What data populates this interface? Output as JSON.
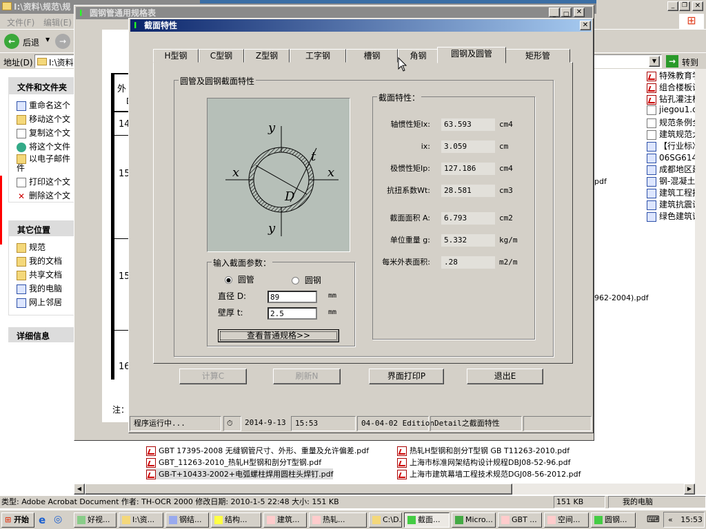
{
  "explorer": {
    "title": "I:\\资料\\规范\\规",
    "menu": [
      "文件(F)",
      "编辑(E)"
    ],
    "back_label": "后退",
    "address_label": "地址(D)",
    "address_value": "I:\\资料",
    "go_label": "转到",
    "tasks_header": "文件和文件夹",
    "tasks": [
      "重命名这个",
      "移动这个文",
      "复制这个文",
      "将这个文件",
      "以电子邮件\n件",
      "打印这个文",
      "删除这个文"
    ],
    "places_header": "其它位置",
    "places": [
      "规范",
      "我的文档",
      "共享文档",
      "我的电脑",
      "网上邻居"
    ],
    "details_header": "详细信息",
    "right_files": [
      {
        "name": "特殊教育学校",
        "type": "pdf"
      },
      {
        "name": "组合楼板设计",
        "type": "pdf"
      },
      {
        "name": "钻孔灌注桩施",
        "type": "pdf"
      },
      {
        "name": "jiegou1.chm",
        "type": "chm"
      },
      {
        "name": "规范条例全集",
        "type": "chm"
      },
      {
        "name": "建筑规范大全",
        "type": "chm"
      },
      {
        "name": "【行业标准】",
        "type": "doc"
      },
      {
        "name": "06SG614-1砌体",
        "type": "doc"
      },
      {
        "name": "成都地区建筑",
        "type": "doc"
      },
      {
        "name": "钢-混凝土组合",
        "type": "doc"
      },
      {
        "name": "建筑工程抗震",
        "type": "doc"
      },
      {
        "name": "建筑抗震设计",
        "type": "doc"
      },
      {
        "name": "绿色建筑评价",
        "type": "doc"
      }
    ],
    "partial_texts": [
      "pdf",
      "962-2004).pdf"
    ],
    "bottom_files_left": [
      "GBT 17395-2008 无缝钢管尺寸、外形、重量及允许偏差.pdf",
      "GBT_11263-2010_热轧H型钢和剖分T型钢.pdf",
      "GB-T+10433-2002+电弧螺柱焊用圆柱头焊钉.pdf"
    ],
    "bottom_files_right": [
      "热轧H型钢和剖分T型钢 GB T11263-2010.pdf",
      "上海市标准网架结构设计规程DBJ08-52-96.pdf",
      "上海市建筑幕墙工程技术规范DGJ08-56-2012.pdf"
    ],
    "status": "类型: Adobe Acrobat Document 作者: TH-OCR 2000 修改日期: 2010-1-5 22:48 大小: 151 KB",
    "status_size": "151 KB",
    "status_location": "我的电脑"
  },
  "spec_window": {
    "title": "圆钢管通用规格表",
    "table_cells": [
      "外",
      "D",
      "14",
      "15",
      "15",
      "16"
    ],
    "note": "注："
  },
  "dialog": {
    "title": "截面特性",
    "tabs": [
      "H型钢",
      "C型钢",
      "Z型钢",
      "工字钢",
      "槽钢",
      "角钢",
      "圆钢及圆管",
      "矩形管"
    ],
    "active_tab": 6,
    "group_title": "圆管及圆钢截面特性",
    "diagram_labels": {
      "y": "y",
      "x": "x",
      "t": "t",
      "D": "D"
    },
    "input": {
      "title": "输入截面参数：",
      "radio_tube": "圆管",
      "radio_bar": "圆钢",
      "selected": "圆管",
      "d_label": "直径 D:",
      "d_value": "89",
      "d_unit": "mm",
      "t_label": "壁厚 t:",
      "t_value": "2.5",
      "t_unit": "mm",
      "view_button": "查看普通规格>>"
    },
    "props": {
      "title": "截面特性：",
      "rows": [
        {
          "label": "轴惯性矩Ix:",
          "value": "63.593",
          "unit": "cm4"
        },
        {
          "label": "ix:",
          "value": "3.059",
          "unit": "cm"
        },
        {
          "label": "极惯性矩Ip:",
          "value": "127.186",
          "unit": "cm4"
        },
        {
          "label": "抗扭系数Wt:",
          "value": "28.581",
          "unit": "cm3"
        },
        {
          "label": "截面面积 A:",
          "value": "6.793",
          "unit": "cm2"
        },
        {
          "label": "单位重量 g:",
          "value": "5.332",
          "unit": "kg/m"
        },
        {
          "label": "每米外表面积:",
          "value": ".28",
          "unit": "m2/m"
        }
      ]
    },
    "buttons": {
      "calc": "计算C",
      "refresh": "刷新N",
      "print": "界面打印P",
      "exit": "退出E"
    },
    "status": {
      "running": "程序运行中...",
      "date": "2014-9-13",
      "time": "15:53",
      "edition": "04-04-02 Edition",
      "detail": "Detail之截面特性"
    }
  },
  "taskbar": {
    "start": "开始",
    "items": [
      "好视...",
      "I:\\资...",
      "钢结...",
      "结构...",
      "建筑...",
      "热轧...",
      "C:\\D...",
      "截面...",
      "Micro...",
      "GBT ...",
      "空间...",
      "圆钢..."
    ],
    "active_item": 7,
    "clock": "15:53"
  },
  "colors": {
    "active_title": "#0a246a",
    "face": "#d4d0c8",
    "diagram_bg": "#b6bfb8",
    "desktop_taskbar": "#d4d0c8"
  }
}
